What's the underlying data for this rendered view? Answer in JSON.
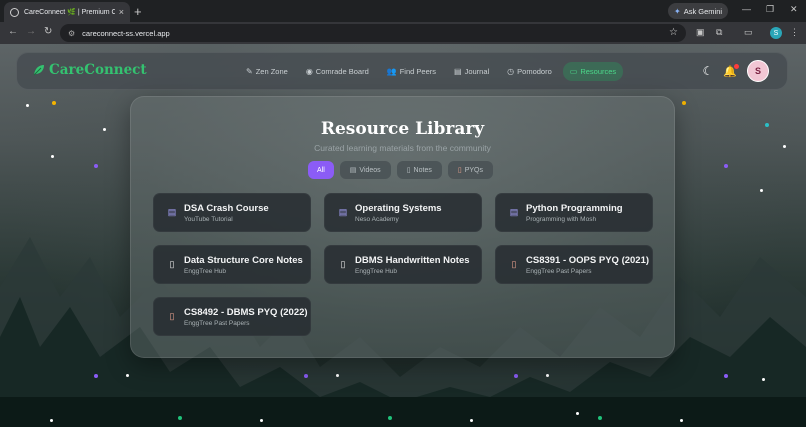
{
  "browser": {
    "tab_title": "CareConnect 🌿 | Premium Ca",
    "tab_close": "×",
    "new_tab": "+",
    "ask_gemini": "Ask Gemini",
    "url": "careconnect-ss.vercel.app",
    "profile_initial": "S",
    "window_controls": [
      "—",
      "❐",
      "✕"
    ]
  },
  "navbar": {
    "brand": "CareConnect",
    "links": [
      {
        "label": "Zen Zone",
        "icon": "feather-icon"
      },
      {
        "label": "Comrade Board",
        "icon": "eye-icon"
      },
      {
        "label": "Find Peers",
        "icon": "users-icon"
      },
      {
        "label": "Journal",
        "icon": "book-icon"
      },
      {
        "label": "Pomodoro",
        "icon": "clock-icon"
      },
      {
        "label": "Resources",
        "icon": "folder-icon"
      }
    ],
    "active": "Resources",
    "avatar_initial": "S"
  },
  "library": {
    "title": "Resource Library",
    "subtitle": "Curated learning materials from the community",
    "filters": [
      "All",
      "Videos",
      "Notes",
      "PYQs"
    ],
    "active_filter": "All",
    "cards": [
      {
        "title": "DSA Crash Course",
        "subtitle": "YouTube Tutorial",
        "icon": "video-icon"
      },
      {
        "title": "Operating Systems",
        "subtitle": "Neso Academy",
        "icon": "video-icon"
      },
      {
        "title": "Python Programming",
        "subtitle": "Programming with Mosh",
        "icon": "video-icon"
      },
      {
        "title": "Data Structure Core Notes",
        "subtitle": "EnggTree Hub",
        "icon": "document-icon"
      },
      {
        "title": "DBMS Handwritten Notes",
        "subtitle": "EnggTree Hub",
        "icon": "document-icon"
      },
      {
        "title": "CS8391 - OOPS PYQ (2021)",
        "subtitle": "EnggTree Past Papers",
        "icon": "pdf-icon"
      },
      {
        "title": "CS8492 - DBMS PYQ (2022)",
        "subtitle": "EnggTree Past Papers",
        "icon": "pdf-icon"
      }
    ]
  },
  "colors": {
    "brand_green": "#34c270",
    "accent_purple": "#8b5cf6",
    "notification_red": "#ff3b3b"
  }
}
